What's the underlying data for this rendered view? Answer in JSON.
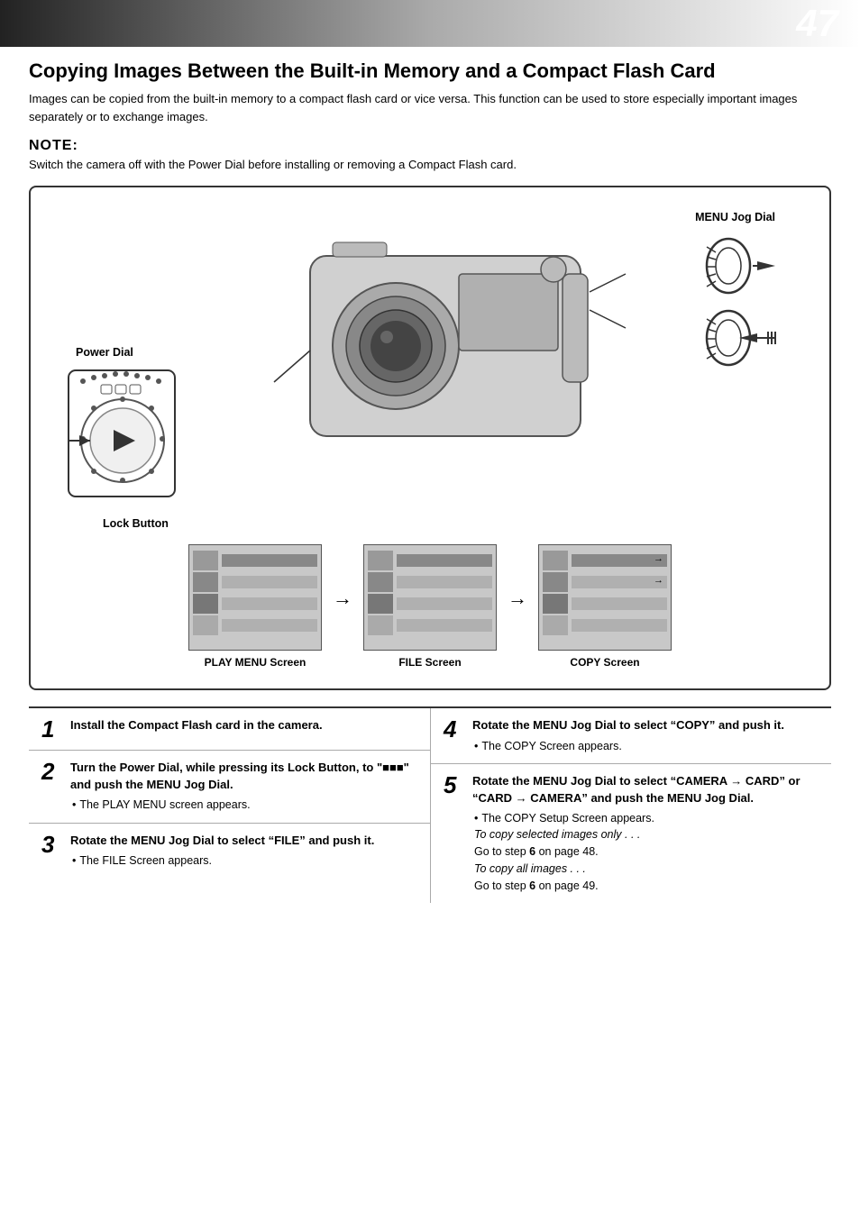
{
  "page": {
    "number": "47",
    "title": "Copying Images Between the Built-in Memory and a Compact Flash Card",
    "intro": "Images can be copied from the built-in memory to a compact flash card or vice versa. This function can be used to store especially important images separately or to exchange images.",
    "note_label": "NOTE:",
    "note_text": "Switch the camera off with the Power Dial before installing or removing a Compact Flash card.",
    "diagram": {
      "label_menu_jog": "MENU Jog Dial",
      "label_power_dial": "Power Dial",
      "label_lock_button": "Lock Button",
      "screen1_label": "PLAY MENU Screen",
      "screen2_label": "FILE Screen",
      "screen3_label": "COPY Screen"
    },
    "steps": [
      {
        "number": "1",
        "main": "Install the Compact Flash card in the camera.",
        "bullets": []
      },
      {
        "number": "2",
        "main": "Turn the Power Dial, while pressing its Lock Button, to \"■■■\" and push the MENU Jog Dial.",
        "bullets": [
          "The PLAY MENU screen appears."
        ]
      },
      {
        "number": "3",
        "main": "Rotate the MENU Jog Dial to select “FILE” and push it.",
        "bullets": [
          "The FILE Screen appears."
        ]
      },
      {
        "number": "4",
        "main": "Rotate the MENU Jog Dial to select “COPY” and push it.",
        "bullets": [
          "The COPY Screen appears."
        ]
      },
      {
        "number": "5",
        "main": "Rotate the MENU Jog Dial to select “CAMERA → CARD” or “CARD → CAMERA” and push the MENU Jog Dial.",
        "bullets": [
          "The COPY Setup Screen appears.",
          "italic:To copy selected images only . . .",
          "Go to step 6 on page 48.",
          "italic:To copy all images . . .",
          "Go to step 6 on page 49."
        ]
      }
    ]
  }
}
